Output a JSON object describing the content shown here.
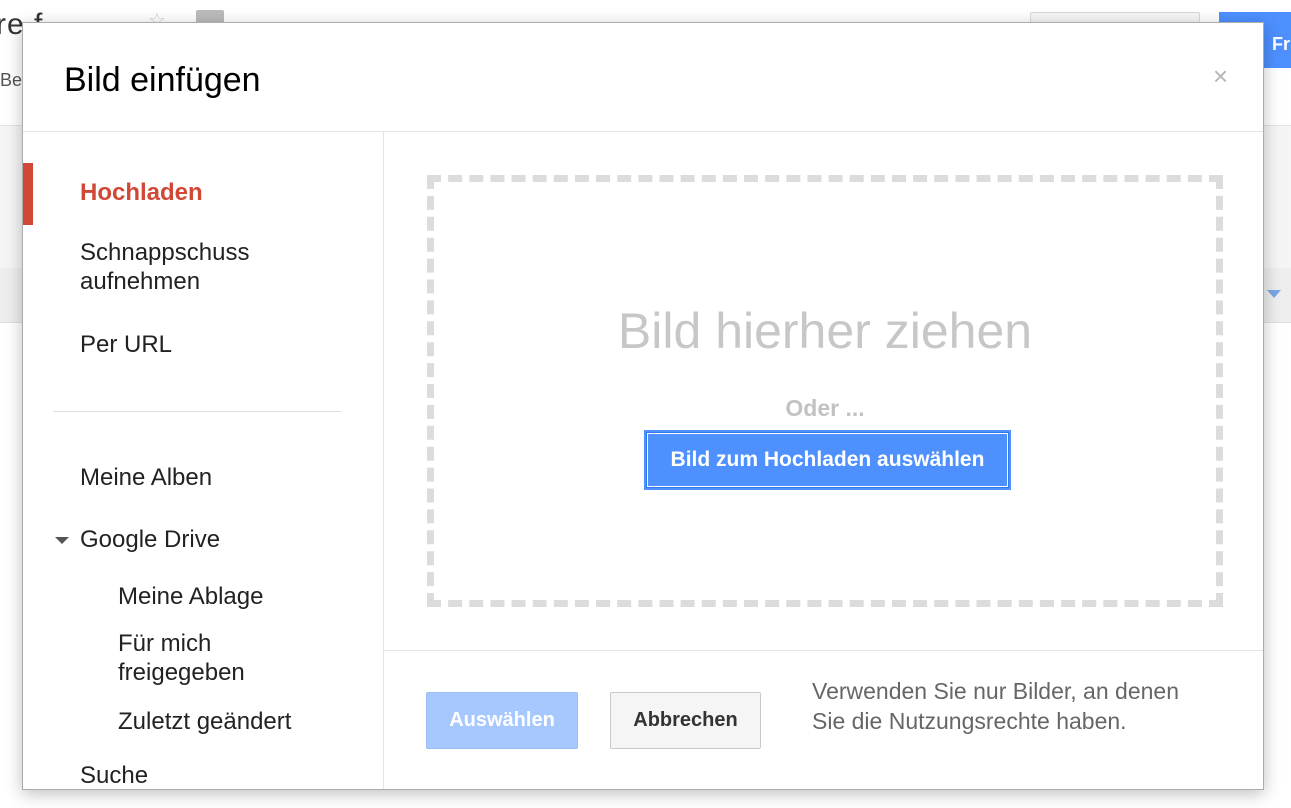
{
  "background": {
    "doc_title_fragment": "re f",
    "menu_fragment": "Be",
    "share_button_fragment": "Fr"
  },
  "dialog": {
    "title": "Bild einfügen",
    "close_glyph": "×"
  },
  "sidebar": {
    "items": [
      {
        "label": "Hochladen",
        "active": true
      },
      {
        "label": "Schnappschuss\naufnehmen"
      },
      {
        "label": "Per URL"
      }
    ],
    "sources": [
      {
        "label": "Meine Alben"
      },
      {
        "label": "Google Drive",
        "expanded": true
      },
      {
        "label": "Meine Ablage"
      },
      {
        "label": "Für mich\nfreigegeben"
      },
      {
        "label": "Zuletzt geändert"
      },
      {
        "label": "Suche"
      }
    ]
  },
  "dropzone": {
    "title": "Bild hierher ziehen",
    "or_text": "Oder ...",
    "upload_button": "Bild zum Hochladen auswählen"
  },
  "footer": {
    "select_button": "Auswählen",
    "cancel_button": "Abbrechen",
    "note": "Verwenden Sie nur Bilder, an denen Sie die Nutzungsrechte haben."
  },
  "colors": {
    "accent_red": "#d14836",
    "primary_blue": "#4d90fe",
    "disabled_blue": "#a6c8ff"
  }
}
